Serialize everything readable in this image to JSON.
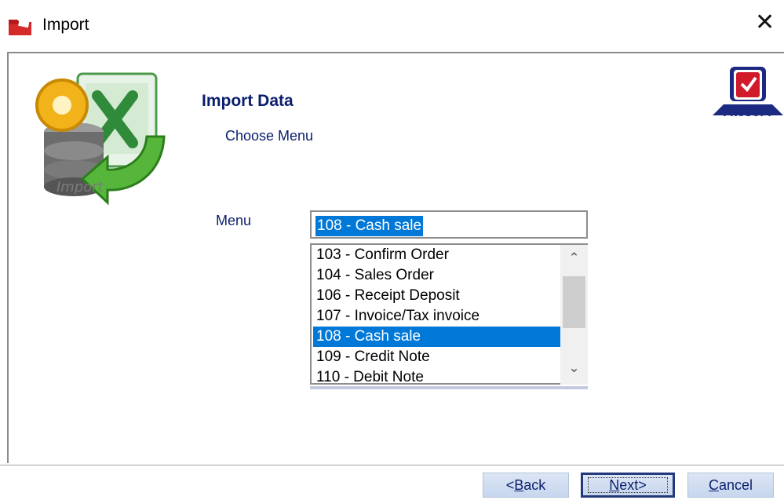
{
  "window": {
    "title": "Import",
    "close_glyph": "✕",
    "app_icon": "red-folder-icon"
  },
  "left_graphic": {
    "icon": "import-database-icon",
    "caption": "Import"
  },
  "logo": {
    "icon": "prosoft-logo-icon",
    "text": "PROSOFT"
  },
  "header": {
    "title": "Import Data",
    "subtitle": "Choose Menu"
  },
  "menu": {
    "label": "Menu",
    "value": "108 - Cash sale",
    "options": [
      "103 - Confirm Order",
      "104 - Sales Order",
      "106 - Receipt Deposit",
      "107 - Invoice/Tax invoice",
      "108 - Cash sale",
      "109 - Credit Note",
      "110 - Debit Note"
    ],
    "selected_index": 4,
    "selection_color": "#0078d7"
  },
  "buttons": {
    "back_prefix": "<",
    "back_mnemonic": "B",
    "back_rest": "ack",
    "next_mnemonic": "N",
    "next_rest": "ext>",
    "cancel_mnemonic": "C",
    "cancel_rest": "ancel"
  },
  "colors": {
    "label_text": "#0b1e6d",
    "button_face": "#c7d6ee"
  }
}
